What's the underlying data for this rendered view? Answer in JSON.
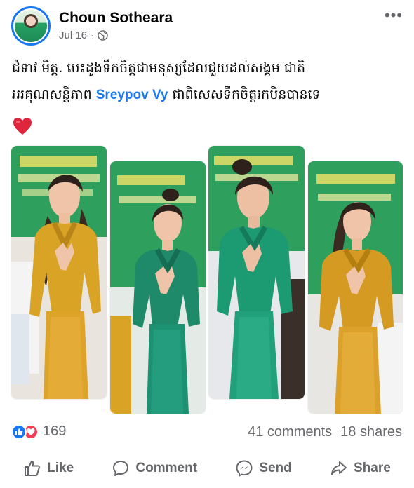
{
  "post": {
    "author": "Choun Sotheara",
    "date": "Jul 16",
    "separator": "·",
    "caption_line1": "ជំទាវ មិត្ត. បេះដូងទឹកចិត្តជាមនុស្សដែលជួយដល់សង្គម ជាតិ",
    "caption_line2_prefix": "អរគុណសន្តិភាព",
    "mention": "Sreypov Vy",
    "caption_line2_suffix": "ជាពិសេសទឹកចិត្តរកមិនបានទេ",
    "emoji": "heart",
    "photos": [
      {
        "outfit_color": "#d9a326",
        "pose": "hands-together"
      },
      {
        "outfit_color": "#1f8a6a",
        "pose": "hands-together"
      },
      {
        "outfit_color": "#1c9a72",
        "pose": "hands-together"
      },
      {
        "outfit_color": "#d59a22",
        "pose": "hands-together"
      }
    ]
  },
  "stats": {
    "reaction_count": "169",
    "comments": "41 comments",
    "shares": "18 shares"
  },
  "actions": {
    "like": "Like",
    "comment": "Comment",
    "send": "Send",
    "share": "Share"
  },
  "colors": {
    "accent": "#1877f2",
    "secondary_text": "#65676b",
    "love": "#f33e58",
    "banner_green": "#2fa25e"
  },
  "icons": [
    "globe-icon",
    "more-options-icon",
    "heart-emoji-icon",
    "like-reaction-icon",
    "love-reaction-icon",
    "like-icon",
    "comment-icon",
    "send-icon",
    "share-icon"
  ]
}
